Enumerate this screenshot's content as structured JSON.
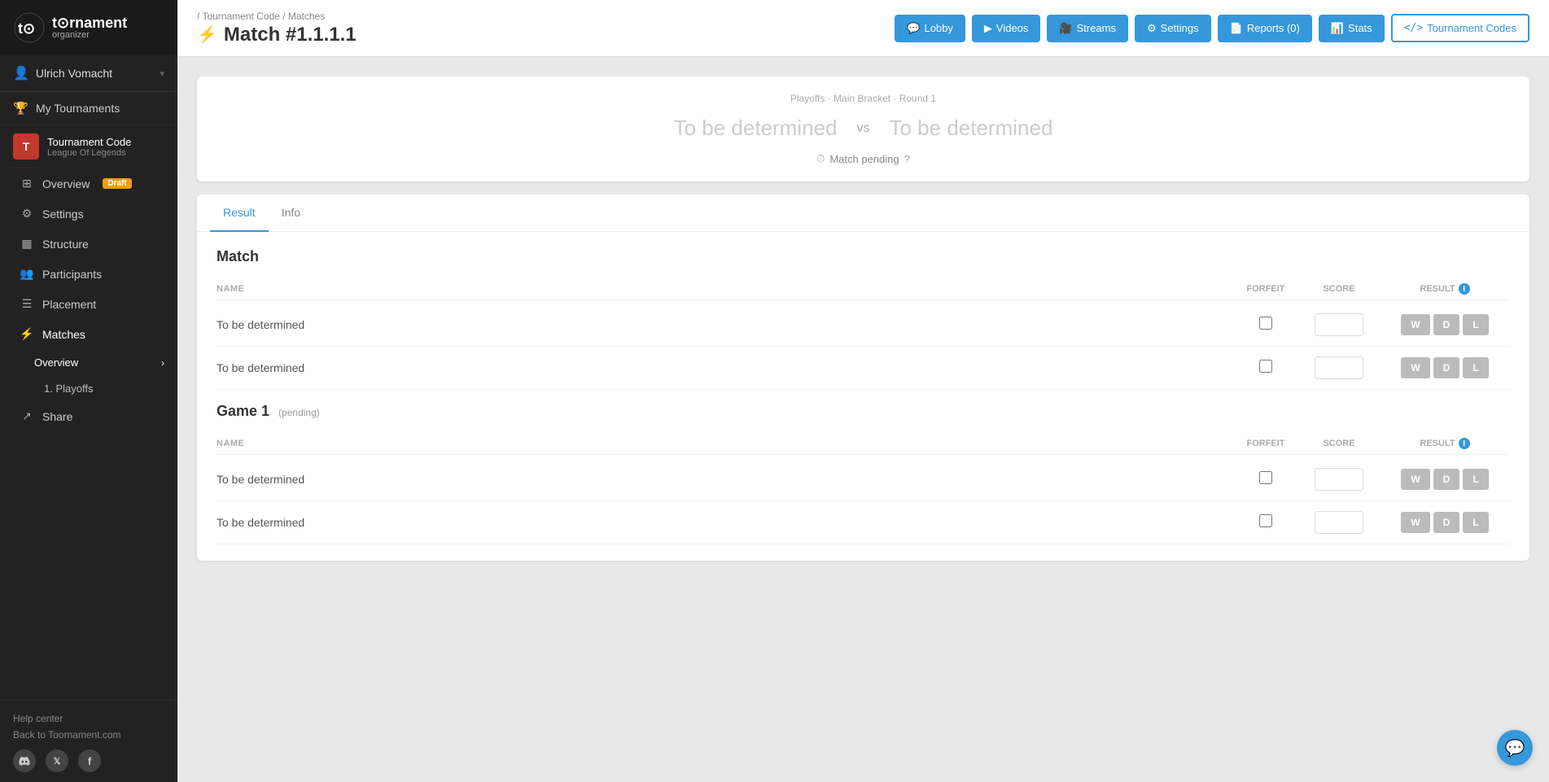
{
  "sidebar": {
    "logo": {
      "text": "t⊙rnament",
      "sub": "organizer"
    },
    "user": {
      "name": "Ulrich Vomacht",
      "icon": "👤"
    },
    "my_tournaments_label": "My Tournaments",
    "tournament": {
      "name": "Tournament Code",
      "game": "League Of Legends",
      "badge": "Draft"
    },
    "nav_items": [
      {
        "id": "overview",
        "label": "Overview",
        "icon": "⊞"
      },
      {
        "id": "settings",
        "label": "Settings",
        "icon": "⚙"
      },
      {
        "id": "structure",
        "label": "Structure",
        "icon": "▦"
      },
      {
        "id": "participants",
        "label": "Participants",
        "icon": "👥"
      },
      {
        "id": "placement",
        "label": "Placement",
        "icon": "☰"
      },
      {
        "id": "matches",
        "label": "Matches",
        "icon": "⚡",
        "active": true
      }
    ],
    "matches_sub": [
      {
        "id": "overview",
        "label": "Overview",
        "has_arrow": true
      },
      {
        "id": "playoffs",
        "label": "1. Playoffs"
      }
    ],
    "share_label": "Share",
    "help_label": "Help center",
    "back_label": "Back to Toornament.com",
    "social": [
      {
        "id": "discord",
        "icon": "⌂"
      },
      {
        "id": "twitter",
        "icon": "𝕏"
      },
      {
        "id": "facebook",
        "icon": "f"
      }
    ]
  },
  "header": {
    "breadcrumb": "/ Tournament Code / Matches",
    "title": "Match #1.1.1.1",
    "lightning": "⚡",
    "buttons": [
      {
        "id": "lobby",
        "label": "Lobby",
        "icon": "💬"
      },
      {
        "id": "videos",
        "label": "Videos",
        "icon": "▶"
      },
      {
        "id": "streams",
        "label": "Streams",
        "icon": "🎥"
      },
      {
        "id": "settings",
        "label": "Settings",
        "icon": "⚙"
      },
      {
        "id": "reports",
        "label": "Reports (0)",
        "icon": "📄"
      },
      {
        "id": "stats",
        "label": "Stats",
        "icon": "📊"
      },
      {
        "id": "tournament-codes",
        "label": "Tournament Codes",
        "icon": "</>"
      }
    ]
  },
  "match_info": {
    "subtitle": "Playoffs · Main Bracket · Round 1",
    "team1": "To be determined",
    "team2": "To be determined",
    "vs": "vs",
    "status": "Match pending",
    "status_icon": "⏱",
    "help_icon": "?"
  },
  "tabs": [
    {
      "id": "result",
      "label": "Result",
      "active": true
    },
    {
      "id": "info",
      "label": "Info"
    }
  ],
  "match_section": {
    "title": "Match",
    "col_name": "NAME",
    "col_forfeit": "FORFEIT",
    "col_score": "SCORE",
    "col_result": "RESULT",
    "rows": [
      {
        "name": "To be determined"
      },
      {
        "name": "To be determined"
      }
    ],
    "result_buttons": [
      "W",
      "D",
      "L"
    ]
  },
  "game1_section": {
    "title": "Game 1",
    "pending_label": "(pending)",
    "col_name": "NAME",
    "col_forfeit": "FORFEIT",
    "col_score": "SCORE",
    "col_result": "RESULT",
    "rows": [
      {
        "name": "To be determined"
      },
      {
        "name": "To be determined"
      }
    ],
    "result_buttons": [
      "W",
      "D",
      "L"
    ]
  },
  "chat_button": {
    "icon": "💬"
  }
}
